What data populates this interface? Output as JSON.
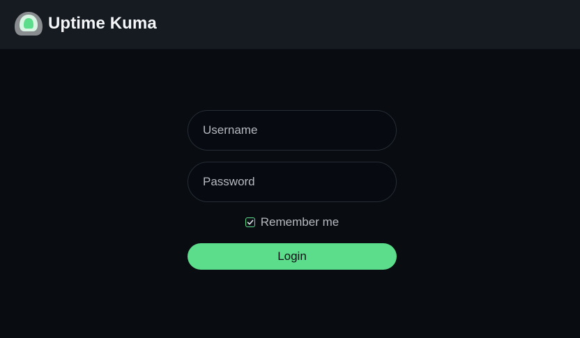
{
  "header": {
    "app_name": "Uptime Kuma",
    "logo_icon": "uptime-kuma-logo"
  },
  "login": {
    "username_placeholder": "Username",
    "username_value": "",
    "password_placeholder": "Password",
    "password_value": "",
    "remember_label": "Remember me",
    "remember_checked": true,
    "submit_label": "Login"
  },
  "colors": {
    "accent": "#5cdd8b",
    "header_bg": "#161b22",
    "page_bg": "#090c10"
  }
}
